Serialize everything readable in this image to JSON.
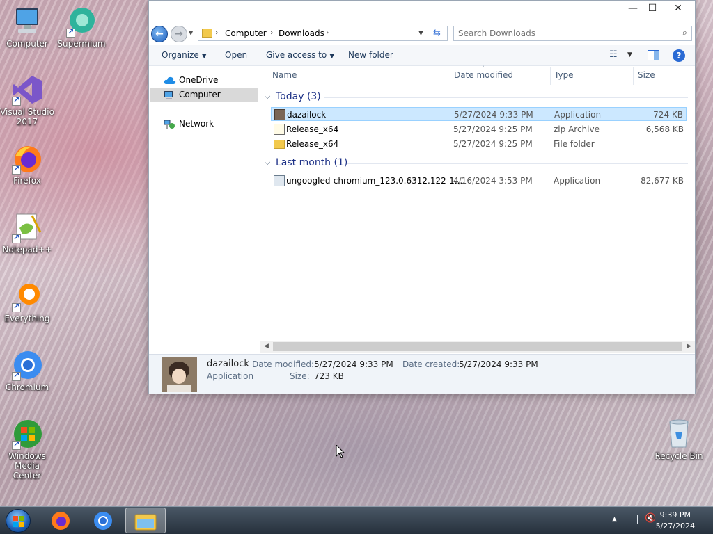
{
  "desktop": {
    "icons": [
      {
        "label": "Computer"
      },
      {
        "label": "Supermium"
      },
      {
        "label": "Visual Studio 2017"
      },
      {
        "label": "Firefox"
      },
      {
        "label": "Notepad++"
      },
      {
        "label": "Everything"
      },
      {
        "label": "Chromium"
      },
      {
        "label": "Windows Media Center"
      },
      {
        "label": "Recycle Bin"
      }
    ]
  },
  "window": {
    "controls": {
      "minimize": "—",
      "maximize": "☐",
      "close": "✕"
    },
    "address": {
      "breadcrumbs": [
        "Computer",
        "Downloads"
      ],
      "search_placeholder": "Search Downloads"
    },
    "toolbar": {
      "organize": "Organize",
      "open": "Open",
      "give_access": "Give access to",
      "new_folder": "New folder"
    },
    "nav": {
      "items": [
        {
          "label": "OneDrive"
        },
        {
          "label": "Computer"
        },
        {
          "label": "Network"
        }
      ]
    },
    "columns": {
      "name": "Name",
      "date": "Date modified",
      "type": "Type",
      "size": "Size"
    },
    "groups": [
      {
        "title": "Today (3)",
        "files": [
          {
            "name": "dazailock",
            "date": "5/27/2024 9:33 PM",
            "type": "Application",
            "size": "724 KB"
          },
          {
            "name": "Release_x64",
            "date": "5/27/2024 9:25 PM",
            "type": "zip Archive",
            "size": "6,568 KB"
          },
          {
            "name": "Release_x64",
            "date": "5/27/2024 9:25 PM",
            "type": "File folder",
            "size": ""
          }
        ]
      },
      {
        "title": "Last month (1)",
        "files": [
          {
            "name": "ungoogled-chromium_123.0.6312.122-1....",
            "date": "4/16/2024 3:53 PM",
            "type": "Application",
            "size": "82,677 KB"
          }
        ]
      }
    ],
    "details": {
      "name": "dazailock",
      "type": "Application",
      "date_modified_label": "Date modified:",
      "date_modified": "5/27/2024 9:33 PM",
      "date_created_label": "Date created:",
      "date_created": "5/27/2024 9:33 PM",
      "size_label": "Size:",
      "size": "723 KB"
    }
  },
  "taskbar": {
    "time": "9:39 PM",
    "date": "5/27/2024"
  }
}
